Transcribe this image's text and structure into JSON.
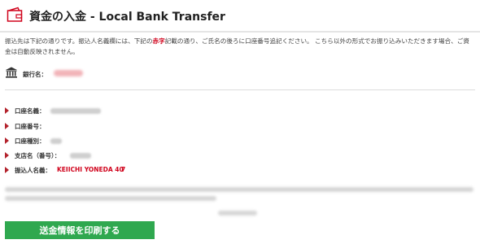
{
  "header": {
    "title": "資金の入金 - Local Bank Transfer",
    "icon": "wallet-icon"
  },
  "notice": {
    "text_before": "振込先は下記の通りです。振込人名義欄には、下記の",
    "highlight": "赤字",
    "text_after": "記載の通り、ご氏名の後ろに口座番号追記ください。 こちら以外の形式でお振り込みいただきます場合、ご資金は自動反映されません。"
  },
  "bank": {
    "icon": "bank-icon",
    "label": "銀行名："
  },
  "fields": {
    "account_name": "口座名義：",
    "account_number": "口座番号：",
    "account_type": "口座種別：",
    "branch": "支店名（番号）：",
    "payer_name": "振込人名義："
  },
  "payer": {
    "name": "KEIICHI YONEDA 40",
    "suffix": "7"
  },
  "print_button": "送金情報を印刷する",
  "colors": {
    "accent_red": "#d0021b",
    "button_green": "#2fa84f",
    "bullet_red": "#b3222c"
  }
}
